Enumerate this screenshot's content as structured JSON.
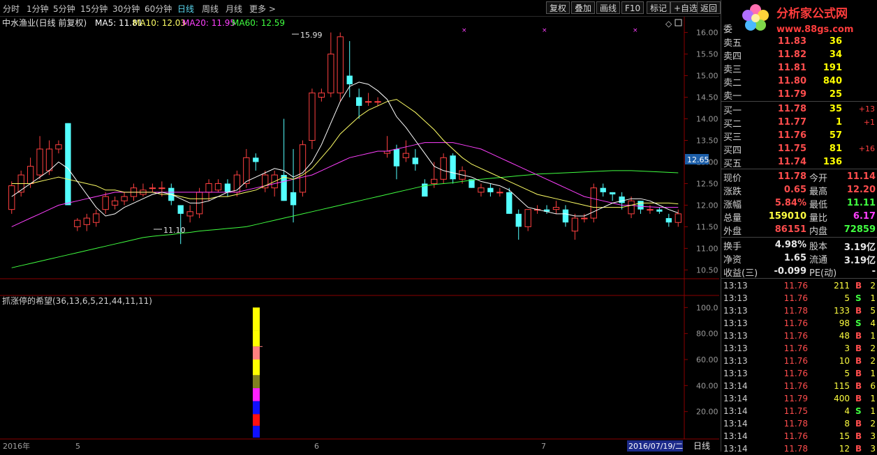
{
  "toolbar": {
    "periods": [
      "分时",
      "1分钟",
      "5分钟",
      "15分钟",
      "30分钟",
      "60分钟",
      "日线",
      "周线",
      "月线",
      "更多 >"
    ],
    "active": "日线",
    "buttons": [
      "复权",
      "叠加",
      "画线",
      "F10",
      "标记",
      "+自选",
      "返回"
    ]
  },
  "header": {
    "stock": "中水渔业(日线 前复权)",
    "ma5_label": "MA5: 11.81",
    "ma10_label": "MA10: 12.03",
    "ma20_label": "MA20: 11.95",
    "ma60_label": "MA60: 12.59"
  },
  "annotations": {
    "high": "15.99",
    "low": "11.10",
    "current_price": "12.65"
  },
  "indicator": {
    "title": "抓涨停的希望(36,13,6,5,21,44,11,11)"
  },
  "price_axis": [
    "16.00",
    "15.50",
    "15.00",
    "14.50",
    "14.00",
    "13.50",
    "13.00",
    "12.50",
    "12.00",
    "11.50",
    "11.00",
    "10.50"
  ],
  "ind_axis": [
    "100.0",
    "80.00",
    "60.00",
    "40.00",
    "20.00"
  ],
  "date_axis": {
    "year": "2016年",
    "m5": "5",
    "m6": "6",
    "m7": "7",
    "cursor": "2016/07/19/二",
    "period_btn": "日线"
  },
  "colors": {
    "up": "#ff4040",
    "down": "#54ffff",
    "ma5": "#ffffff",
    "ma10": "#ffff66",
    "ma20": "#ff40ff",
    "ma60": "#40ff40"
  },
  "quote": {
    "partial_label": "委",
    "logo_text": "分析家公式网",
    "logo_url": "www.88gs.com",
    "sell": [
      {
        "label": "卖五",
        "price": "11.83",
        "vol": "36"
      },
      {
        "label": "卖四",
        "price": "11.82",
        "vol": "34"
      },
      {
        "label": "卖三",
        "price": "11.81",
        "vol": "191"
      },
      {
        "label": "卖二",
        "price": "11.80",
        "vol": "840"
      },
      {
        "label": "卖一",
        "price": "11.79",
        "vol": "25"
      }
    ],
    "buy": [
      {
        "label": "买一",
        "price": "11.78",
        "vol": "35",
        "chg": "+13"
      },
      {
        "label": "买二",
        "price": "11.77",
        "vol": "1",
        "chg": "+1"
      },
      {
        "label": "买三",
        "price": "11.76",
        "vol": "57",
        "chg": ""
      },
      {
        "label": "买四",
        "price": "11.75",
        "vol": "81",
        "chg": "+16"
      },
      {
        "label": "买五",
        "price": "11.74",
        "vol": "136",
        "chg": ""
      }
    ],
    "stats": [
      {
        "l1": "现价",
        "v1": "11.78",
        "c1": "#ff4d4d",
        "l2": "今开",
        "v2": "11.14",
        "c2": "#ff4d4d"
      },
      {
        "l1": "涨跌",
        "v1": "0.65",
        "c1": "#ff4d4d",
        "l2": "最高",
        "v2": "12.20",
        "c2": "#ff4d4d"
      },
      {
        "l1": "涨幅",
        "v1": "5.84%",
        "c1": "#ff4d4d",
        "l2": "最低",
        "v2": "11.11",
        "c2": "#40ff40"
      },
      {
        "l1": "总量",
        "v1": "159010",
        "c1": "#ffff40",
        "l2": "量比",
        "v2": "6.17",
        "c2": "#ff40ff"
      },
      {
        "l1": "外盘",
        "v1": "86151",
        "c1": "#ff4d4d",
        "l2": "内盘",
        "v2": "72859",
        "c2": "#40ff40"
      }
    ],
    "stats2": [
      {
        "l1": "换手",
        "v1": "4.98%",
        "l2": "股本",
        "v2": "3.19亿"
      },
      {
        "l1": "净资",
        "v1": "1.65",
        "l2": "流通",
        "v2": "3.19亿"
      },
      {
        "l1": "收益(三)",
        "v1": "-0.099",
        "l2": "PE(动)",
        "v2": "-"
      }
    ],
    "ticks": [
      {
        "t": "13:13",
        "p": "11.76",
        "v": "211",
        "bs": "B",
        "n": "2"
      },
      {
        "t": "13:13",
        "p": "11.76",
        "v": "5",
        "bs": "S",
        "n": "1"
      },
      {
        "t": "13:13",
        "p": "11.78",
        "v": "133",
        "bs": "B",
        "n": "5"
      },
      {
        "t": "13:13",
        "p": "11.76",
        "v": "98",
        "bs": "S",
        "n": "4"
      },
      {
        "t": "13:13",
        "p": "11.76",
        "v": "48",
        "bs": "B",
        "n": "1"
      },
      {
        "t": "13:13",
        "p": "11.76",
        "v": "3",
        "bs": "B",
        "n": "2"
      },
      {
        "t": "13:13",
        "p": "11.76",
        "v": "10",
        "bs": "B",
        "n": "2"
      },
      {
        "t": "13:13",
        "p": "11.76",
        "v": "5",
        "bs": "B",
        "n": "1"
      },
      {
        "t": "13:14",
        "p": "11.76",
        "v": "115",
        "bs": "B",
        "n": "6"
      },
      {
        "t": "13:14",
        "p": "11.79",
        "v": "400",
        "bs": "B",
        "n": "1"
      },
      {
        "t": "13:14",
        "p": "11.75",
        "v": "4",
        "bs": "S",
        "n": "1"
      },
      {
        "t": "13:14",
        "p": "11.78",
        "v": "8",
        "bs": "B",
        "n": "2"
      },
      {
        "t": "13:14",
        "p": "11.76",
        "v": "15",
        "bs": "B",
        "n": "3"
      },
      {
        "t": "13:14",
        "p": "11.78",
        "v": "12",
        "bs": "B",
        "n": "3"
      }
    ]
  },
  "chart_data": {
    "type": "candlestick",
    "ylim": [
      10.2,
      16.3
    ],
    "candles": [
      [
        11.9,
        12.45,
        12.55,
        11.8
      ],
      [
        12.3,
        12.7,
        12.8,
        12.2
      ],
      [
        12.5,
        12.9,
        13.1,
        12.4
      ],
      [
        12.7,
        13.3,
        13.6,
        12.6
      ],
      [
        12.8,
        13.3,
        13.5,
        12.7
      ],
      [
        13.3,
        13.4,
        13.5,
        13.2
      ],
      [
        13.9,
        12.0,
        13.9,
        12.0
      ],
      [
        11.5,
        11.65,
        11.7,
        11.4
      ],
      [
        11.55,
        11.7,
        11.8,
        11.4
      ],
      [
        11.6,
        11.8,
        11.9,
        11.5
      ],
      [
        11.9,
        12.2,
        12.3,
        11.8
      ],
      [
        12.0,
        12.1,
        12.2,
        11.9
      ],
      [
        12.1,
        12.2,
        12.3,
        12.0
      ],
      [
        12.2,
        12.4,
        12.5,
        12.1
      ],
      [
        12.25,
        12.35,
        12.5,
        12.2
      ],
      [
        12.4,
        12.4,
        12.5,
        12.3
      ],
      [
        12.4,
        12.4,
        12.55,
        12.2
      ],
      [
        12.4,
        12.1,
        12.5,
        12.0
      ],
      [
        12.0,
        11.8,
        12.0,
        11.1
      ],
      [
        11.75,
        11.85,
        12.0,
        11.6
      ],
      [
        11.8,
        12.3,
        12.4,
        11.7
      ],
      [
        12.3,
        12.5,
        12.6,
        12.1
      ],
      [
        12.35,
        12.5,
        12.6,
        12.3
      ],
      [
        12.5,
        12.3,
        12.6,
        12.2
      ],
      [
        12.3,
        12.7,
        12.8,
        12.2
      ],
      [
        12.5,
        13.1,
        13.3,
        12.4
      ],
      [
        13.1,
        13.0,
        13.2,
        12.8
      ],
      [
        12.4,
        12.7,
        12.8,
        12.3
      ],
      [
        12.4,
        12.7,
        12.8,
        12.2
      ],
      [
        12.7,
        12.1,
        14.0,
        12.1
      ],
      [
        12.3,
        12.0,
        13.3,
        11.6
      ],
      [
        12.3,
        13.4,
        13.5,
        12.2
      ],
      [
        13.5,
        14.6,
        14.7,
        13.3
      ],
      [
        14.5,
        14.6,
        14.7,
        14.4
      ],
      [
        14.6,
        15.5,
        16.0,
        14.5
      ],
      [
        14.6,
        15.9,
        16.0,
        14.4
      ],
      [
        15.0,
        14.8,
        15.8,
        14.5
      ],
      [
        14.5,
        14.3,
        14.7,
        14.0
      ],
      [
        14.4,
        14.4,
        14.6,
        14.3
      ],
      [
        14.4,
        14.4,
        14.5,
        14.3
      ],
      [
        13.2,
        13.25,
        13.6,
        13.1
      ],
      [
        13.3,
        12.9,
        13.4,
        12.6
      ],
      [
        13.1,
        13.2,
        13.5,
        13.0
      ],
      [
        13.1,
        12.95,
        13.3,
        12.8
      ],
      [
        12.5,
        12.2,
        12.6,
        12.2
      ],
      [
        12.5,
        12.6,
        13.0,
        12.4
      ],
      [
        12.6,
        13.1,
        13.2,
        12.5
      ],
      [
        13.15,
        12.6,
        13.2,
        12.5
      ],
      [
        12.6,
        12.8,
        12.9,
        12.5
      ],
      [
        12.6,
        12.4,
        12.6,
        12.4
      ],
      [
        12.3,
        12.4,
        12.5,
        12.2
      ],
      [
        12.4,
        12.3,
        12.5,
        12.2
      ],
      [
        12.3,
        12.3,
        12.4,
        12.2
      ],
      [
        12.3,
        11.8,
        12.4,
        11.8
      ],
      [
        11.8,
        11.5,
        11.9,
        11.2
      ],
      [
        11.5,
        11.9,
        11.9,
        11.4
      ],
      [
        11.9,
        11.9,
        12.0,
        11.8
      ],
      [
        11.9,
        11.85,
        12.0,
        11.8
      ],
      [
        11.9,
        11.95,
        12.1,
        11.8
      ],
      [
        11.9,
        11.6,
        12.0,
        11.5
      ],
      [
        11.4,
        11.7,
        11.8,
        11.2
      ],
      [
        11.7,
        11.7,
        11.8,
        11.6
      ],
      [
        11.7,
        12.4,
        12.5,
        11.6
      ],
      [
        12.4,
        12.3,
        12.5,
        12.2
      ],
      [
        12.3,
        12.25,
        12.3,
        12.1
      ],
      [
        12.2,
        12.05,
        12.3,
        11.9
      ],
      [
        11.8,
        12.1,
        12.2,
        11.7
      ],
      [
        12.1,
        11.9,
        12.1,
        11.8
      ],
      [
        11.9,
        11.9,
        12.0,
        11.8
      ],
      [
        11.9,
        11.85,
        11.95,
        11.8
      ],
      [
        11.7,
        11.6,
        11.8,
        11.5
      ],
      [
        11.6,
        11.8,
        11.9,
        11.5
      ]
    ],
    "ma5": [
      12.2,
      12.35,
      12.5,
      12.65,
      12.8,
      13.0,
      12.85,
      12.55,
      12.25,
      11.95,
      11.75,
      11.8,
      11.95,
      12.05,
      12.15,
      12.25,
      12.3,
      12.25,
      12.15,
      12.05,
      12.05,
      12.1,
      12.2,
      12.3,
      12.35,
      12.55,
      12.65,
      12.75,
      12.85,
      12.8,
      12.65,
      12.75,
      13.0,
      13.4,
      13.9,
      14.4,
      14.75,
      14.85,
      14.8,
      14.65,
      14.45,
      14.05,
      13.8,
      13.5,
      13.2,
      12.9,
      12.8,
      12.75,
      12.7,
      12.65,
      12.55,
      12.5,
      12.45,
      12.35,
      12.15,
      11.95,
      11.9,
      11.85,
      11.8,
      11.8,
      11.75,
      11.75,
      11.85,
      11.95,
      12.05,
      12.1,
      12.15,
      12.15,
      12.1,
      12.0,
      11.9,
      11.82
    ],
    "ma10": [
      12.5,
      12.5,
      12.5,
      12.55,
      12.6,
      12.65,
      12.6,
      12.55,
      12.5,
      12.45,
      12.35,
      12.35,
      12.3,
      12.3,
      12.3,
      12.3,
      12.25,
      12.25,
      12.2,
      12.15,
      12.15,
      12.15,
      12.2,
      12.2,
      12.25,
      12.3,
      12.35,
      12.45,
      12.55,
      12.65,
      12.6,
      12.7,
      12.85,
      13.1,
      13.35,
      13.65,
      13.85,
      14.05,
      14.2,
      14.3,
      14.4,
      14.45,
      14.3,
      14.15,
      13.95,
      13.75,
      13.5,
      13.3,
      13.1,
      12.95,
      12.85,
      12.75,
      12.65,
      12.55,
      12.45,
      12.35,
      12.25,
      12.2,
      12.15,
      12.1,
      12.05,
      12.0,
      11.95,
      11.95,
      11.95,
      11.95,
      12.0,
      12.05,
      12.05,
      12.05,
      12.05,
      12.03
    ],
    "ma20": [
      11.5,
      11.6,
      11.7,
      11.8,
      11.9,
      12.0,
      12.05,
      12.1,
      12.15,
      12.2,
      12.25,
      12.3,
      12.3,
      12.3,
      12.3,
      12.3,
      12.3,
      12.3,
      12.3,
      12.3,
      12.3,
      12.3,
      12.3,
      12.3,
      12.3,
      12.35,
      12.4,
      12.45,
      12.5,
      12.55,
      12.6,
      12.65,
      12.7,
      12.8,
      12.9,
      13.0,
      13.1,
      13.15,
      13.2,
      13.25,
      13.25,
      13.3,
      13.35,
      13.4,
      13.45,
      13.45,
      13.45,
      13.45,
      13.4,
      13.35,
      13.3,
      13.2,
      13.1,
      13.0,
      12.9,
      12.8,
      12.7,
      12.6,
      12.5,
      12.4,
      12.3,
      12.2,
      12.15,
      12.1,
      12.05,
      12.0,
      12.0,
      11.97,
      11.96,
      11.95,
      11.95,
      11.95
    ],
    "ma60": [
      10.55,
      10.6,
      10.65,
      10.7,
      10.75,
      10.8,
      10.85,
      10.9,
      10.95,
      11.0,
      11.05,
      11.1,
      11.15,
      11.2,
      11.25,
      11.28,
      11.3,
      11.32,
      11.35,
      11.37,
      11.4,
      11.42,
      11.44,
      11.46,
      11.48,
      11.5,
      11.55,
      11.6,
      11.65,
      11.7,
      11.75,
      11.8,
      11.85,
      11.9,
      11.95,
      12.0,
      12.05,
      12.1,
      12.15,
      12.2,
      12.25,
      12.3,
      12.35,
      12.4,
      12.45,
      12.48,
      12.5,
      12.52,
      12.55,
      12.58,
      12.6,
      12.62,
      12.64,
      12.66,
      12.68,
      12.7,
      12.72,
      12.73,
      12.74,
      12.75,
      12.76,
      12.77,
      12.78,
      12.79,
      12.8,
      12.8,
      12.8,
      12.79,
      12.78,
      12.77,
      12.76,
      12.75
    ],
    "indicator_ylim": [
      0,
      105
    ],
    "indicator_bars": [
      {
        "from": 82,
        "to": 100,
        "color": "#ffff00"
      },
      {
        "from": 70,
        "to": 82,
        "color": "#ffff00"
      },
      {
        "from": 60,
        "to": 70,
        "color": "#ff8080"
      },
      {
        "from": 48,
        "to": 60,
        "color": "#ffff00"
      },
      {
        "from": 38,
        "to": 48,
        "color": "#808020"
      },
      {
        "from": 28,
        "to": 38,
        "color": "#ff20ff"
      },
      {
        "from": 18,
        "to": 28,
        "color": "#1010ff"
      },
      {
        "from": 9,
        "to": 18,
        "color": "#ff1010"
      },
      {
        "from": 0,
        "to": 9,
        "color": "#1010ff"
      }
    ]
  }
}
